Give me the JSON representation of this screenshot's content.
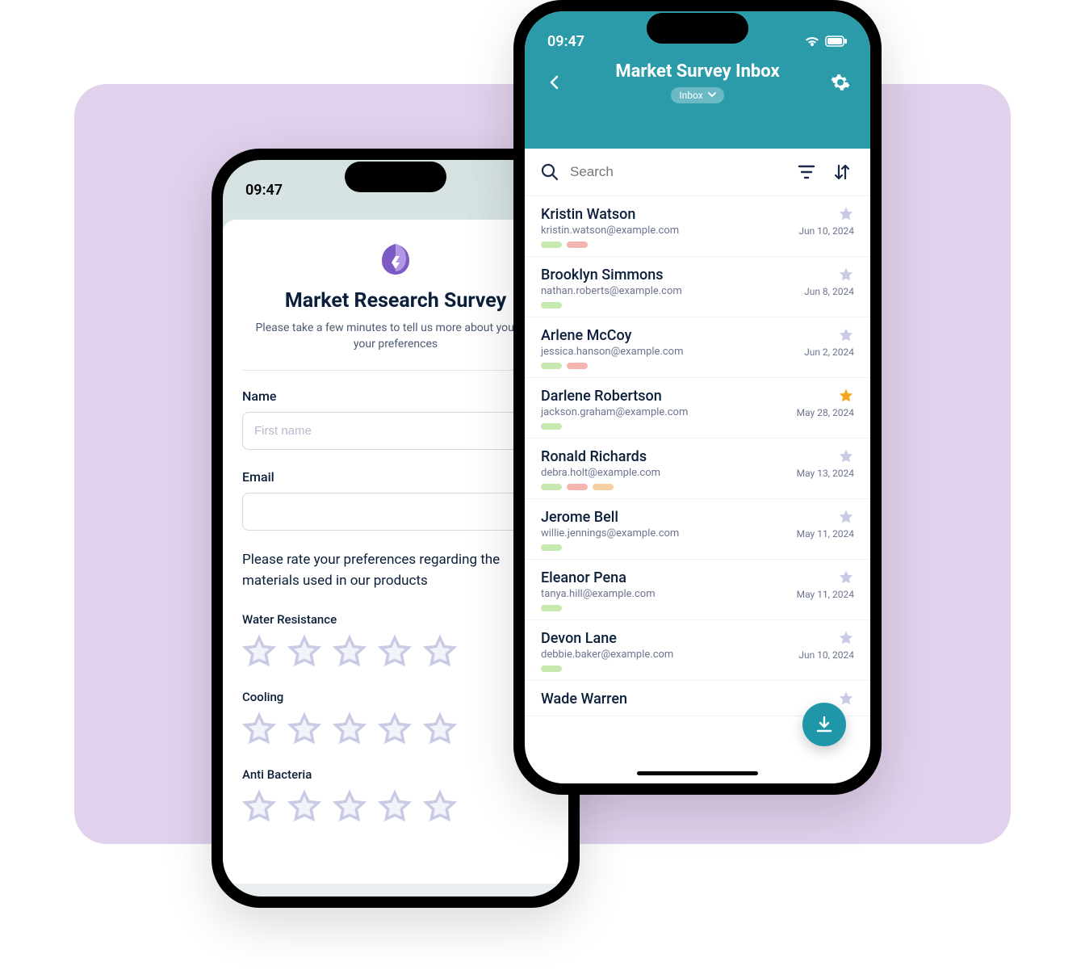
{
  "status_time": "09:47",
  "survey": {
    "title": "Market Research Survey",
    "subtitle": "Please take a few minutes to tell us more about you and your preferences",
    "name_label": "Name",
    "name_placeholder": "First name",
    "email_label": "Email",
    "question": "Please rate your preferences regarding the materials used in our products",
    "ratings": [
      "Water Resistance",
      "Cooling",
      "Anti Bacteria"
    ]
  },
  "inbox": {
    "header_title": "Market Survey Inbox",
    "chip_label": "Inbox",
    "search_placeholder": "Search",
    "items": [
      {
        "name": "Kristin Watson",
        "email": "kristin.watson@example.com",
        "date": "Jun 10, 2024",
        "starred": false,
        "tags": [
          "green",
          "pink"
        ]
      },
      {
        "name": "Brooklyn Simmons",
        "email": "nathan.roberts@example.com",
        "date": "Jun 8, 2024",
        "starred": false,
        "tags": [
          "green"
        ]
      },
      {
        "name": "Arlene McCoy",
        "email": "jessica.hanson@example.com",
        "date": "Jun 2, 2024",
        "starred": false,
        "tags": [
          "green",
          "pink"
        ]
      },
      {
        "name": "Darlene Robertson",
        "email": "jackson.graham@example.com",
        "date": "May 28, 2024",
        "starred": true,
        "tags": [
          "green"
        ]
      },
      {
        "name": "Ronald Richards",
        "email": "debra.holt@example.com",
        "date": "May 13, 2024",
        "starred": false,
        "tags": [
          "green",
          "pink",
          "orange"
        ]
      },
      {
        "name": "Jerome Bell",
        "email": "willie.jennings@example.com",
        "date": "May 11, 2024",
        "starred": false,
        "tags": [
          "green"
        ]
      },
      {
        "name": "Eleanor Pena",
        "email": "tanya.hill@example.com",
        "date": "May 11, 2024",
        "starred": false,
        "tags": [
          "green"
        ]
      },
      {
        "name": "Devon Lane",
        "email": "debbie.baker@example.com",
        "date": "Jun 10, 2024",
        "starred": false,
        "tags": [
          "green"
        ]
      },
      {
        "name": "Wade Warren",
        "email": "",
        "date": "",
        "starred": false,
        "tags": []
      }
    ]
  }
}
